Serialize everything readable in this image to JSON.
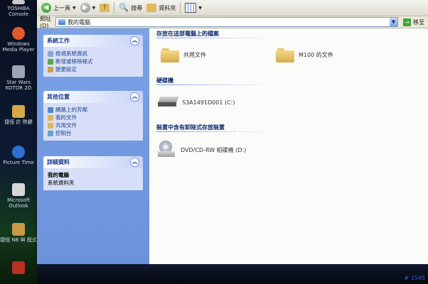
{
  "desktop": {
    "icons": [
      {
        "label": "TOSHIBA Console",
        "color": "#c9c9c9"
      },
      {
        "label": "Windows Media Player",
        "color": "#e15a2b"
      },
      {
        "label": "Star Wars KOTOR 2D",
        "color": "#9da4b3"
      },
      {
        "label": "捷徑 於 熱鍵",
        "color": "#d7a848"
      },
      {
        "label": "Picture Time",
        "color": "#2f6fd1"
      },
      {
        "label": "Microsoft Outlook",
        "color": "#d8d8d8"
      },
      {
        "label": "捷徑 NB 與 程式",
        "color": "#c99a44"
      },
      {
        "label": "",
        "color": "#b83020"
      }
    ]
  },
  "toolbar": {
    "back_label": "上一頁",
    "search_label": "搜尋",
    "folders_label": "資料夾"
  },
  "address": {
    "label": "網址(D)",
    "value": "我的電腦",
    "go_label": "移至"
  },
  "left_pane": {
    "system_tasks": {
      "title": "系統工作",
      "items": [
        "檢視系統資訊",
        "新增或移除程式",
        "變更設定"
      ]
    },
    "other_places": {
      "title": "其他位置",
      "items": [
        "網路上的芳鄰",
        "我的文件",
        "共用文件",
        "控制台"
      ]
    },
    "details": {
      "title": "詳細資料",
      "name": "我的電腦",
      "type": "系統資料夾"
    }
  },
  "main": {
    "section_stored": "存放在這部電腦上的檔案",
    "shared_docs": "共用文件",
    "m100_docs": "M100 的文件",
    "section_hdd": "硬碟機",
    "hdd_label": "S3A1491D001 (C:)",
    "section_removable": "裝置中含有卸除式存放裝置",
    "cd_label": "DVD/CD-RW 組碟機 (D:)"
  },
  "photo_stamp": "# 1545"
}
